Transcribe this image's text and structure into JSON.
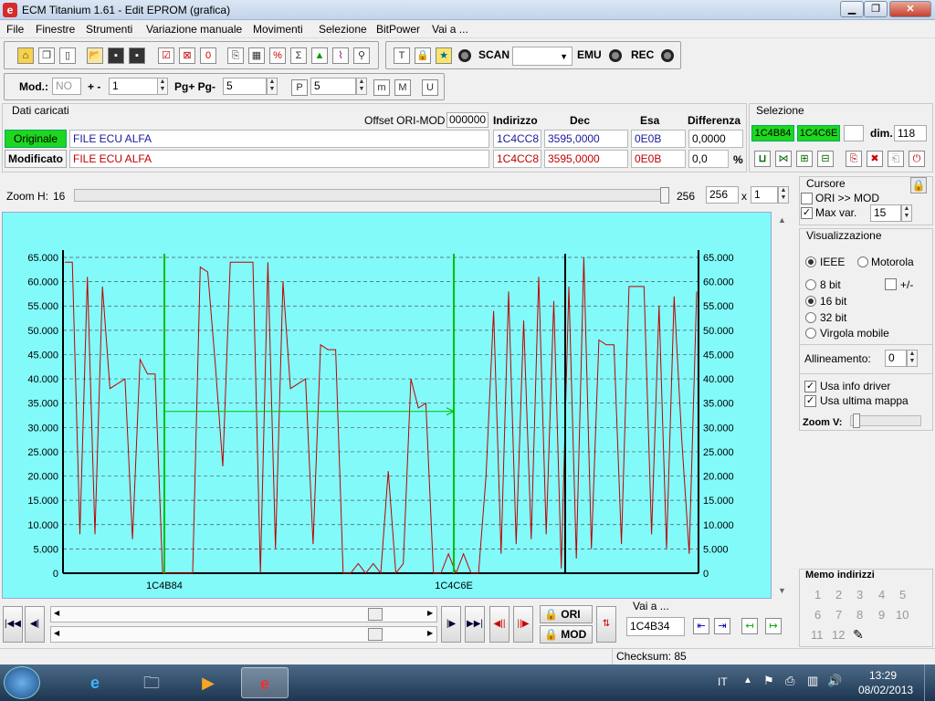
{
  "window": {
    "title": "ECM Titanium 1.61 - Edit EPROM (grafica)"
  },
  "menu": [
    "File",
    "Finestre",
    "Strumenti",
    "Variazione manuale",
    "Movimenti",
    "Selezione",
    "BitPower",
    "Vai a ..."
  ],
  "toolbar1": {
    "scan_label": "SCAN",
    "emu_label": "EMU",
    "rec_label": "REC"
  },
  "toolbar2": {
    "mod_label": "Mod.:",
    "mod_value": "NO",
    "plusminus_label": "+ -",
    "plusminus_value": "1",
    "pg_label": "Pg+ Pg-",
    "pg_value": "5",
    "p_value": "5"
  },
  "dati": {
    "title": "Dati caricati",
    "offset_label": "Offset ORI-MOD",
    "offset_value": "000000",
    "col_indirizzo": "Indirizzo",
    "col_dec": "Dec",
    "col_esa": "Esa",
    "col_diff": "Differenza",
    "originale": {
      "label": "Originale",
      "file": "FILE ECU ALFA",
      "addr": "1C4CC8",
      "dec": "3595,0000",
      "esa": "0E0B",
      "diff": "0,0000"
    },
    "modificato": {
      "label": "Modificato",
      "file": "FILE ECU ALFA",
      "addr": "1C4CC8",
      "dec": "3595,0000",
      "esa": "0E0B",
      "diff": "0,0",
      "pct": "%"
    }
  },
  "selezione": {
    "title": "Selezione",
    "start": "1C4B84",
    "end": "1C4C6E",
    "dim_label": "dim.",
    "dim_value": "118"
  },
  "zoom": {
    "label": "Zoom H:",
    "value": "16",
    "readout": "256",
    "field": "256",
    "x_label": "x",
    "mult": "1"
  },
  "cursore": {
    "title": "Cursore",
    "ori_mod": "ORI >> MOD",
    "max_var_label": "Max var.",
    "max_var_value": "15"
  },
  "visual": {
    "title": "Visualizzazione",
    "ieee": "IEEE",
    "motorola": "Motorola",
    "bit8": "8 bit",
    "pm": "+/-",
    "bit16": "16 bit",
    "bit32": "32 bit",
    "virgola": "Virgola mobile",
    "allineamento_label": "Allineamento:",
    "allineamento_value": "0",
    "info_driver": "Usa info driver",
    "ultima_mappa": "Usa ultima mappa",
    "zoomv": "Zoom V:"
  },
  "nav": {
    "ori": "ORI",
    "mod": "MOD",
    "vai_label": "Vai a ...",
    "vai_value": "1C4B34"
  },
  "memo": {
    "title": "Memo indirizzi",
    "items": [
      "1",
      "2",
      "3",
      "4",
      "5",
      "6",
      "7",
      "8",
      "9",
      "10",
      "11",
      "12"
    ]
  },
  "status": {
    "checksum": "Checksum: 85"
  },
  "taskbar": {
    "lang": "IT",
    "time": "13:29",
    "date": "08/02/2013"
  },
  "chart_data": {
    "type": "line",
    "ylim": [
      0,
      65000
    ],
    "yticks": [
      "65.000",
      "60.000",
      "55.000",
      "50.000",
      "45.000",
      "40.000",
      "35.000",
      "30.000",
      "25.000",
      "20.000",
      "15.000",
      "10.000",
      "5.000",
      "0"
    ],
    "x_markers": [
      "1C4B84",
      "1C4C6E"
    ],
    "series": [
      {
        "values": [
          64000,
          64000,
          8000,
          61000,
          8000,
          59000,
          38000,
          39000,
          40000,
          7000,
          44000,
          41000,
          41000,
          0,
          0,
          0,
          0,
          0,
          63000,
          62000,
          43000,
          22000,
          64000,
          64000,
          64000,
          64000,
          0,
          64000,
          5000,
          60000,
          38000,
          39000,
          40000,
          6000,
          47000,
          46000,
          46000,
          0,
          0,
          2000,
          0,
          2000,
          0,
          21000,
          0,
          2000,
          40000,
          34000,
          35000,
          0,
          0,
          4000,
          0,
          4000,
          0,
          0,
          20000,
          54000,
          4000,
          58000,
          6000,
          52000,
          7000,
          61000,
          8000,
          56000,
          1000,
          59000,
          3000,
          65000,
          5000,
          48000,
          47000,
          47000,
          6000,
          59000,
          59000,
          59000,
          8000,
          55000,
          5000,
          57000,
          28000,
          4000,
          58000
        ]
      }
    ]
  }
}
